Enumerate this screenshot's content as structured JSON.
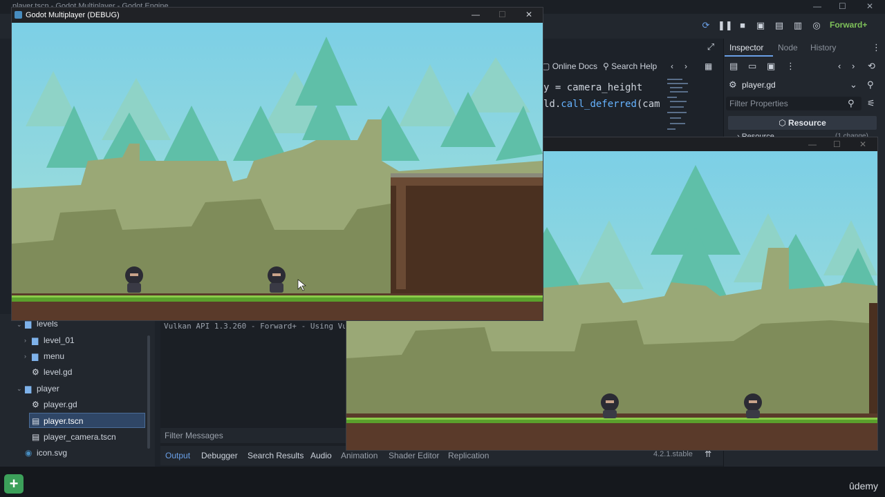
{
  "editor": {
    "title": "player.tscn - Godot Multiplayer - Godot Engine",
    "renderer": "Forward+",
    "window_controls": {
      "minimize": "—",
      "maximize": "☐",
      "close": "✕"
    }
  },
  "inspector": {
    "tabs": [
      {
        "label": "Inspector"
      },
      {
        "label": "Node"
      },
      {
        "label": "History"
      }
    ],
    "resource_name": "player.gd",
    "filter_placeholder": "Filter Properties",
    "section_header": "Resource",
    "subsection": "Resource",
    "change_note": "(1 change)"
  },
  "script_editor": {
    "help_links": [
      {
        "label": "Online Docs"
      },
      {
        "label": "Search Help"
      }
    ],
    "code_lines": [
      "y = camera_height",
      "ld.",
      "call_deferred",
      "(cam"
    ]
  },
  "filesystem": {
    "items": [
      {
        "label": "levels",
        "type": "folder"
      },
      {
        "label": "level_01",
        "type": "folder"
      },
      {
        "label": "menu",
        "type": "folder"
      },
      {
        "label": "level.gd",
        "type": "script"
      },
      {
        "label": "player",
        "type": "folder"
      },
      {
        "label": "player.gd",
        "type": "script"
      },
      {
        "label": "player.tscn",
        "type": "scene"
      },
      {
        "label": "player_camera.tscn",
        "type": "scene"
      },
      {
        "label": "icon.svg",
        "type": "image"
      }
    ]
  },
  "bottom_panel": {
    "log_line": "Vulkan API 1.3.260 - Forward+ - Using Vul",
    "filter_placeholder": "Filter Messages",
    "tabs": [
      {
        "label": "Output"
      },
      {
        "label": "Debugger"
      },
      {
        "label": "Search Results"
      },
      {
        "label": "Audio"
      },
      {
        "label": "Animation"
      },
      {
        "label": "Shader Editor"
      },
      {
        "label": "Replication"
      }
    ],
    "version": "4.2.1.stable"
  },
  "game_windows": [
    {
      "title": "Godot Multiplayer (DEBUG)"
    },
    {
      "title": ""
    }
  ],
  "taskbar": {
    "add_label": "+",
    "brand": "ûdemy"
  },
  "colors": {
    "sky_top": "#7ccfe6",
    "sky_bottom": "#a8e2d6",
    "grass": "#5aa02c",
    "dirt": "#5a3a2a",
    "accent": "#6aa0e8"
  }
}
